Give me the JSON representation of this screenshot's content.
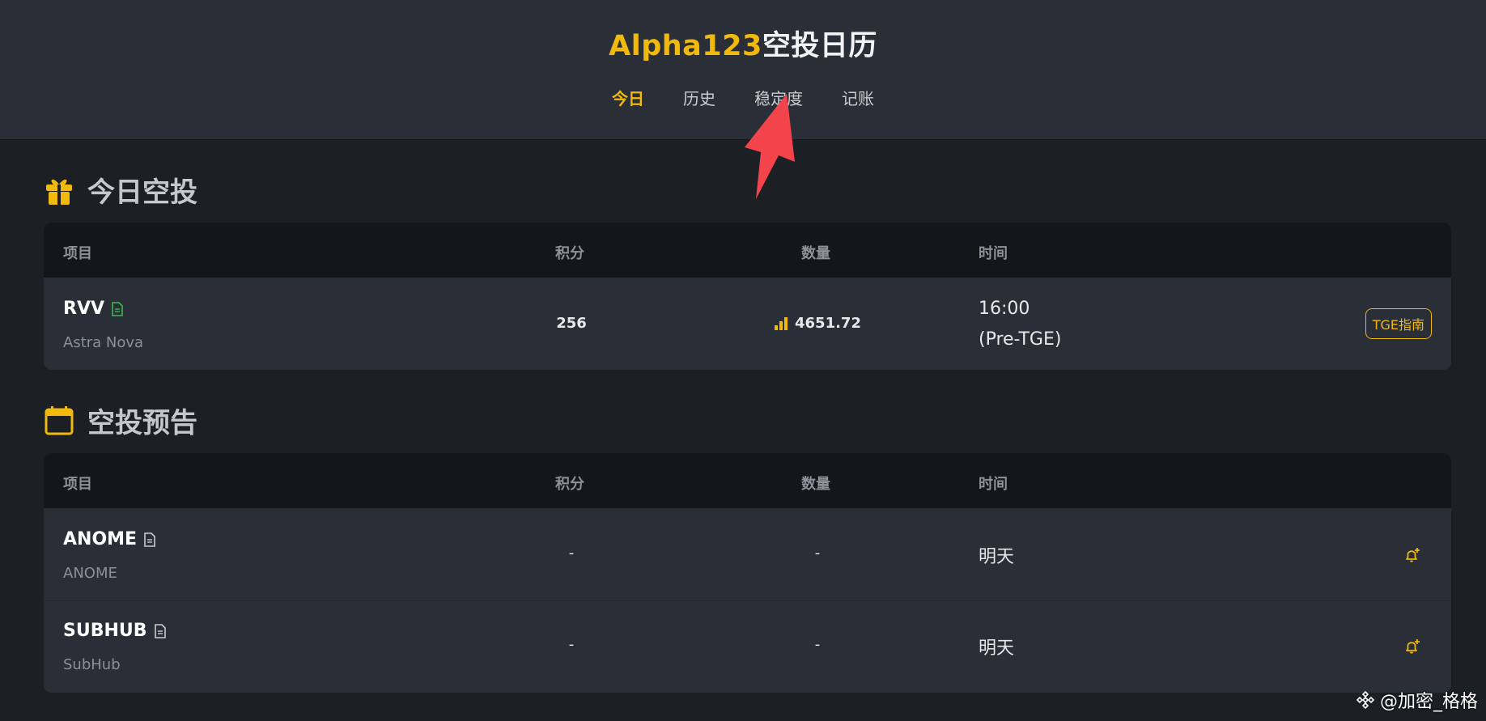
{
  "app": {
    "title_brand": "Alpha123",
    "title_rest": "空投日历"
  },
  "nav": {
    "items": [
      {
        "label": "今日",
        "active": true
      },
      {
        "label": "历史",
        "active": false
      },
      {
        "label": "稳定度",
        "active": false
      },
      {
        "label": "记账",
        "active": false
      }
    ]
  },
  "today": {
    "title": "今日空投",
    "icon": "gift-icon",
    "headers": {
      "project": "项目",
      "points": "积分",
      "amount": "数量",
      "time": "时间"
    },
    "rows": [
      {
        "symbol": "RVV",
        "name": "Astra Nova",
        "points": "256",
        "amount": "4651.72",
        "time_line1": "16:00",
        "time_line2": "(Pre-TGE)",
        "action": "TGE指南"
      }
    ]
  },
  "upcoming": {
    "title": "空投预告",
    "icon": "calendar-icon",
    "headers": {
      "project": "项目",
      "points": "积分",
      "amount": "数量",
      "time": "时间"
    },
    "rows": [
      {
        "symbol": "ANOME",
        "name": "ANOME",
        "points": "-",
        "amount": "-",
        "time": "明天"
      },
      {
        "symbol": "SUBHUB",
        "name": "SubHub",
        "points": "-",
        "amount": "-",
        "time": "明天"
      }
    ]
  },
  "watermark": {
    "text": "@加密_格格"
  },
  "colors": {
    "accent": "#f0b90b",
    "bg": "#1c1f24",
    "panel": "#2a2f37",
    "header_row": "#14161a",
    "arrow": "#f4444b",
    "doc_icon_green": "#3fb950"
  }
}
